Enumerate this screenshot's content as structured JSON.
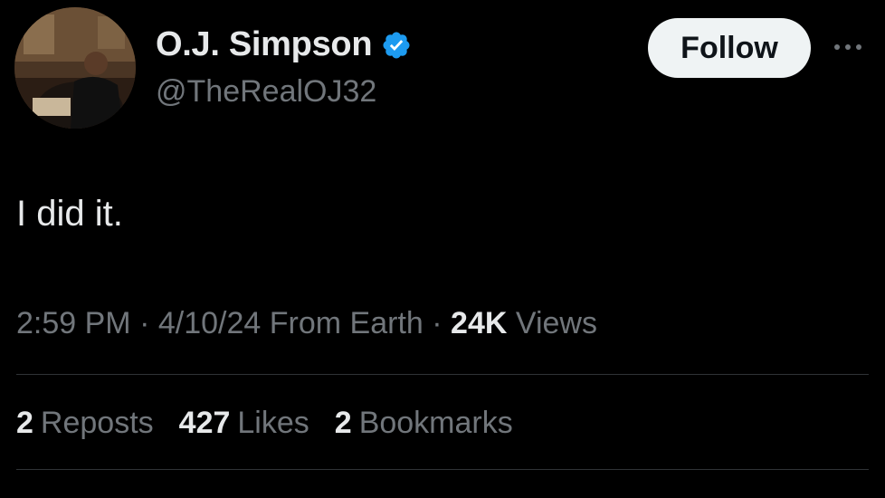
{
  "user": {
    "display_name": "O.J. Simpson",
    "handle": "@TheRealOJ32",
    "verified": true,
    "verified_color": "#1d9bf0"
  },
  "actions": {
    "follow_label": "Follow",
    "more_icon": "more-horizontal-icon"
  },
  "tweet": {
    "text": "I did it.",
    "time": "2:59 PM",
    "separator": "·",
    "date": "4/10/24",
    "source": "From Earth",
    "views_count": "24K",
    "views_label": "Views"
  },
  "stats": {
    "reposts_count": "2",
    "reposts_label": "Reposts",
    "likes_count": "427",
    "likes_label": "Likes",
    "bookmarks_count": "2",
    "bookmarks_label": "Bookmarks"
  },
  "colors": {
    "background": "#000000",
    "primary_text": "#e7e9ea",
    "secondary_text": "#71767b",
    "divider": "#2f3336",
    "follow_bg": "#eff3f4"
  }
}
